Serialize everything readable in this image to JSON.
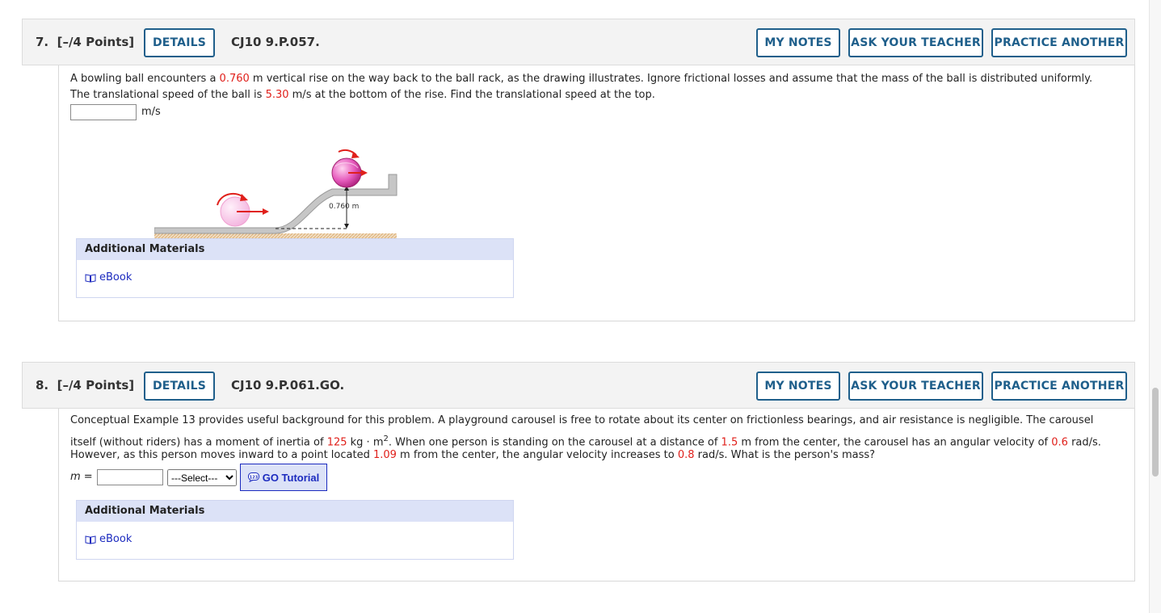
{
  "q7": {
    "number": "7.",
    "points": "[–/4 Points]",
    "details_label": "DETAILS",
    "code": "CJ10 9.P.057.",
    "my_notes_label": "MY NOTES",
    "ask_teacher_label": "ASK YOUR TEACHER",
    "practice_label": "PRACTICE ANOTHER",
    "text1_a": "A bowling ball encounters a ",
    "text1_val": "0.760",
    "text1_b": " m vertical rise on the way back to the ball rack, as the drawing illustrates. Ignore frictional losses and assume that the mass of the ball is distributed uniformly.",
    "text2_a": "The translational speed of the ball is ",
    "text2_val": "5.30",
    "text2_b": " m/s at the bottom of the rise. Find the translational speed at the top.",
    "answer_value": "",
    "unit": "m/s",
    "figure_label": "0.760 m",
    "additional_materials": "Additional Materials",
    "ebook_label": "eBook"
  },
  "q8": {
    "number": "8.",
    "points": "[–/4 Points]",
    "details_label": "DETAILS",
    "code": "CJ10 9.P.061.GO.",
    "my_notes_label": "MY NOTES",
    "ask_teacher_label": "ASK YOUR TEACHER",
    "practice_label": "PRACTICE ANOTHER",
    "line1": "Conceptual Example 13 provides useful background for this problem. A playground carousel is free to rotate about its center on frictionless bearings, and air resistance is negligible. The carousel",
    "line2_a": "itself (without riders) has a moment of inertia of ",
    "line2_inertia": "125",
    "line2_b": " kg · m",
    "line2_sup": "2",
    "line2_c": ". When one person is standing on the carousel at a distance of ",
    "line2_dist": "1.5",
    "line2_d": " m from the center, the carousel has an angular velocity of ",
    "line2_omega": "0.6",
    "line2_e": " rad/s.",
    "line3_a": "However, as this person moves inward to a point located ",
    "line3_dist": "1.09",
    "line3_b": " m from the center, the angular velocity increases to ",
    "line3_omega": "0.8",
    "line3_c": " rad/s. What is the person's mass?",
    "var_label": "m =",
    "answer_value": "",
    "select_value": "---Select---",
    "go_tutorial_label": "GO Tutorial",
    "go_icon_text": "123",
    "additional_materials": "Additional Materials",
    "ebook_label": "eBook"
  },
  "colors": {
    "accent": "#1f5f8b",
    "highlight_red": "#e0201b",
    "link_blue": "#1c2bbf",
    "header_bg": "#f3f3f3",
    "materials_bg": "#dce2f7"
  }
}
